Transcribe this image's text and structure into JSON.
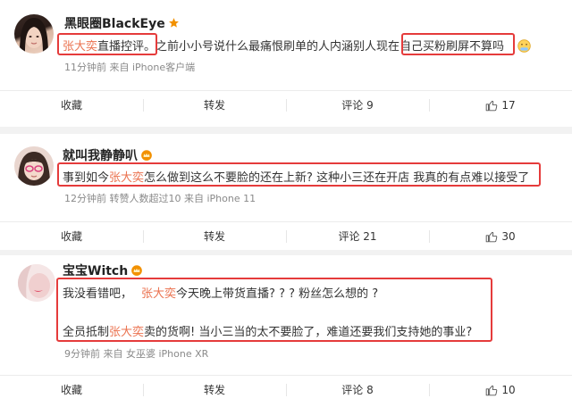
{
  "comments": [
    {
      "username": "黑眼圈BlackEye",
      "body_part1": "张大奕",
      "body_part2": "直播控评。之前小小号说什么最痛恨刷单的人内涵别人现在",
      "body_part3": "自己买粉刷屏不算吗",
      "meta": "11分钟前  来自 iPhone客户端",
      "actions": {
        "collect": "收藏",
        "repost": "转发",
        "comment": "评论 9",
        "like": "17"
      }
    },
    {
      "username": "就叫我静静叭",
      "body_part1": "事到如今",
      "body_part2": "张大奕",
      "body_part3": "怎么做到这么不要脸的还在上新? 这种小三还在开店 我真的有点难以接受了",
      "meta": "12分钟前  转赞人数超过10  来自 iPhone 11",
      "actions": {
        "collect": "收藏",
        "repost": "转发",
        "comment": "评论 21",
        "like": "30"
      }
    },
    {
      "username": "宝宝Witch",
      "line1_part1": "我没看错吧，",
      "line1_part2": "张大奕",
      "line1_part3": "今天晚上带货直播? ? ? 粉丝怎么想的 ?",
      "line2_part1": "全员抵制",
      "line2_part2": "张大奕",
      "line2_part3": "卖的货啊! 当小三当的太不要脸了，难道还要我们支持她的事业?",
      "meta": "9分钟前  来自 女巫婆 iPhone XR",
      "actions": {
        "collect": "收藏",
        "repost": "转发",
        "comment": "评论 8",
        "like": "10"
      }
    }
  ],
  "colors": {
    "highlight": "#eb7350",
    "box": "#e53b3b",
    "badge": "#f29100"
  },
  "icons": [
    "star-badge-icon",
    "emoji-icon",
    "crown-badge-icon",
    "thumbs-up-icon"
  ]
}
